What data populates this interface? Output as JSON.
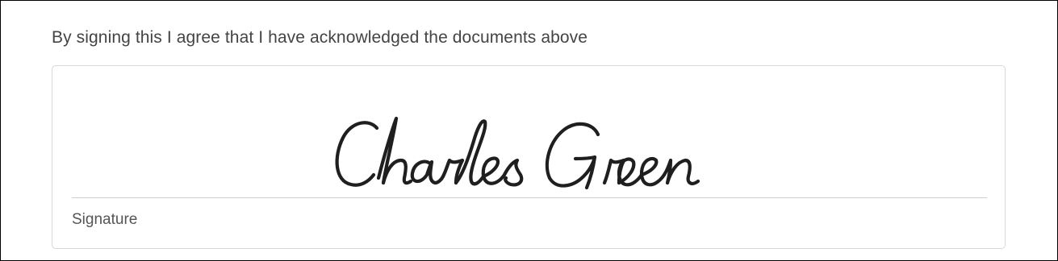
{
  "agreement": {
    "text": "By signing this I agree that I have acknowledged the documents above"
  },
  "signature": {
    "signed_name": "Charles Green",
    "label": "Signature"
  }
}
